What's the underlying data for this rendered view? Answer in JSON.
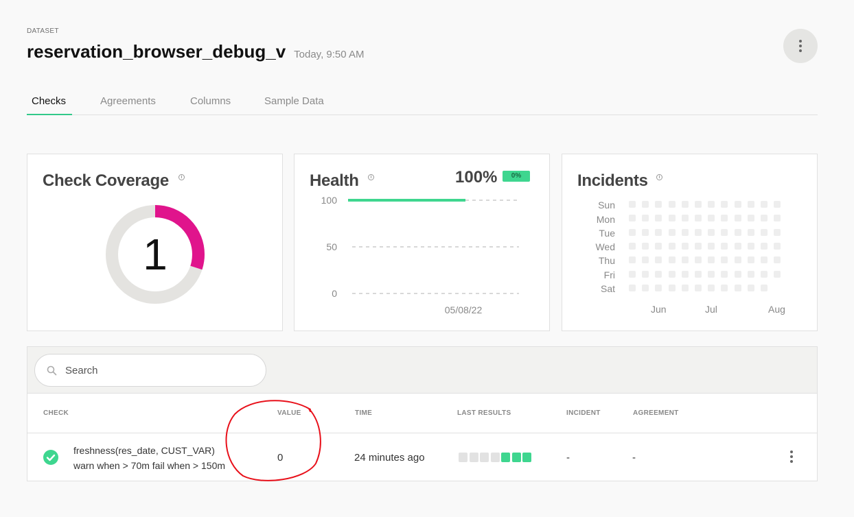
{
  "header": {
    "kicker": "DATASET",
    "title": "reservation_browser_debug_v",
    "timestamp": "Today, 9:50 AM"
  },
  "tabs": [
    {
      "label": "Checks",
      "active": true
    },
    {
      "label": "Agreements",
      "active": false
    },
    {
      "label": "Columns",
      "active": false
    },
    {
      "label": "Sample Data",
      "active": false
    }
  ],
  "coverage": {
    "title": "Check Coverage",
    "value": "1",
    "fraction": 0.3,
    "accent": "#e0148c",
    "track": "#e4e3e0"
  },
  "health": {
    "title": "Health",
    "percent": "100%",
    "badge": "0%",
    "accent": "#3ed68f",
    "y_ticks": [
      "100",
      "50",
      "0"
    ],
    "x_label": "05/08/22"
  },
  "incidents": {
    "title": "Incidents",
    "days": [
      "Sun",
      "Mon",
      "Tue",
      "Wed",
      "Thu",
      "Fri",
      "Sat"
    ],
    "months": [
      "Jun",
      "Jul",
      "Aug"
    ]
  },
  "search": {
    "placeholder": "Search"
  },
  "table": {
    "columns": [
      "CHECK",
      "VALUE",
      "TIME",
      "LAST RESULTS",
      "INCIDENT",
      "AGREEMENT"
    ],
    "rows": [
      {
        "status": "pass",
        "name": "freshness(res_date, CUST_VAR)",
        "rule": "warn when > 70m fail when > 150m",
        "value": "0",
        "time": "24 minutes ago",
        "last_results": [
          "none",
          "none",
          "none",
          "none",
          "pass",
          "pass",
          "pass"
        ],
        "incident": "-",
        "agreement": "-"
      }
    ]
  },
  "colors": {
    "pass": "#3ed68f",
    "none": "#e2e2e2",
    "annotation": "#e8101a"
  }
}
